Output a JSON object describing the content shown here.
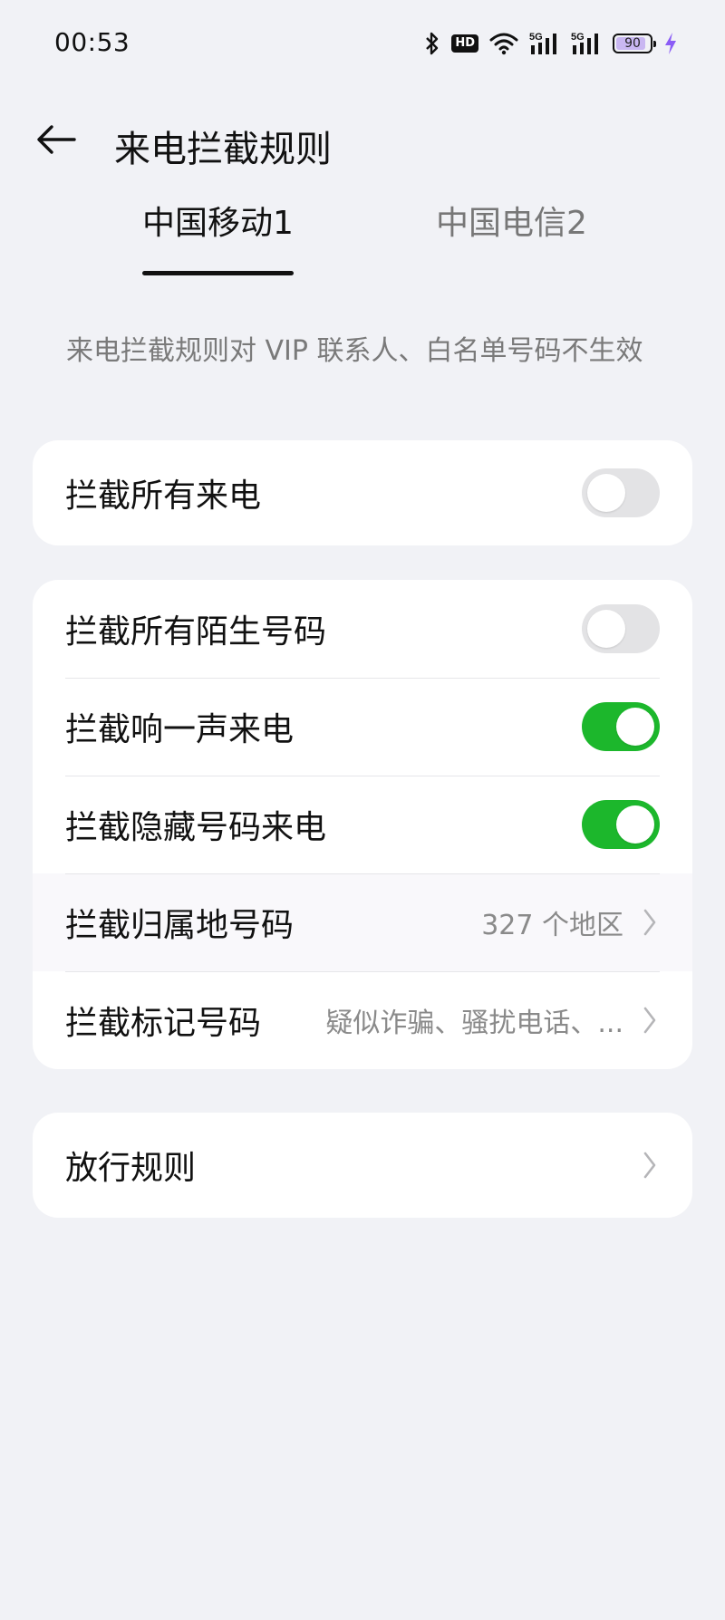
{
  "status_bar": {
    "time": "00:53",
    "hd_label": "HD",
    "network_1": "5G",
    "network_2": "5G",
    "battery_level": "90",
    "battery_percent": 90,
    "icons": [
      "bluetooth-icon",
      "hd-icon",
      "wifi-icon",
      "signal-5g-icon",
      "signal-5g-icon",
      "battery-icon",
      "charging-icon"
    ],
    "colors": {
      "battery_fill": "#c9b7f2",
      "charging": "#8b5cf6"
    }
  },
  "header": {
    "title": "来电拦截规则",
    "back_icon": "back-arrow-icon"
  },
  "tabs": [
    {
      "label": "中国移动1",
      "selected": true
    },
    {
      "label": "中国电信2",
      "selected": false
    }
  ],
  "notice": "来电拦截规则对 VIP 联系人、白名单号码不生效",
  "cards": {
    "block_all": {
      "label": "拦截所有来电",
      "enabled": false
    },
    "rules": {
      "block_strangers": {
        "label": "拦截所有陌生号码",
        "enabled": false
      },
      "block_one_ring": {
        "label": "拦截响一声来电",
        "enabled": true
      },
      "block_hidden": {
        "label": "拦截隐藏号码来电",
        "enabled": true
      },
      "block_region": {
        "label": "拦截归属地号码",
        "value": "327 个地区"
      },
      "block_marked": {
        "label": "拦截标记号码",
        "value": "疑似诈骗、骚扰电话、..."
      }
    },
    "allow_rules": {
      "label": "放行规则"
    }
  },
  "colors": {
    "toggle_on": "#1cb72c",
    "toggle_off": "#e3e3e5",
    "background": "#f1f2f6"
  }
}
